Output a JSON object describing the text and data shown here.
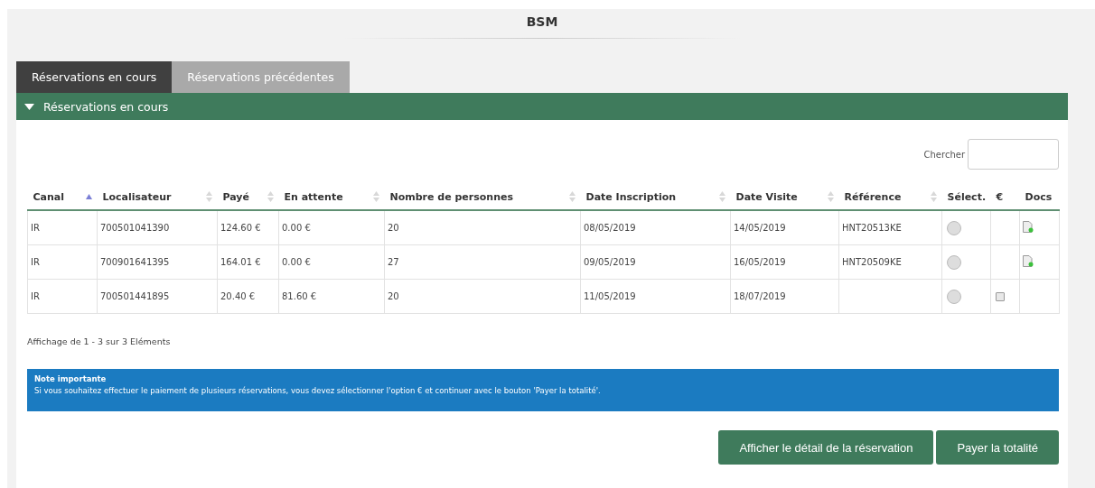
{
  "header": {
    "title": "BSM"
  },
  "tabs": [
    {
      "label": "Réservations en cours",
      "selected": true
    },
    {
      "label": "Réservations précédentes",
      "selected": false
    }
  ],
  "panel": {
    "title": "Réservations en cours",
    "expanded": true
  },
  "search": {
    "label": "Chercher"
  },
  "table": {
    "columns": [
      {
        "label": "Canal",
        "sortable": true,
        "sorted": true
      },
      {
        "label": "Localisateur",
        "sortable": true,
        "sorted": false
      },
      {
        "label": "Payé",
        "sortable": true,
        "sorted": false
      },
      {
        "label": "En attente",
        "sortable": true,
        "sorted": false
      },
      {
        "label": "Nombre de personnes",
        "sortable": true,
        "sorted": false
      },
      {
        "label": "Date Inscription",
        "sortable": true,
        "sorted": false
      },
      {
        "label": "Date Visite",
        "sortable": true,
        "sorted": false
      },
      {
        "label": "Référence",
        "sortable": true,
        "sorted": false
      },
      {
        "label": "Sélect."
      },
      {
        "label": "€"
      },
      {
        "label": "Docs"
      }
    ],
    "rows": [
      {
        "cells": [
          "IR",
          "700501041390",
          "124.60 €",
          "0.00 €",
          "20",
          "08/05/2019",
          "14/05/2019",
          "HNT20513KE"
        ],
        "selected": false,
        "has_docs": true
      },
      {
        "cells": [
          "IR",
          "700901641395",
          "164.01 €",
          "0.00 €",
          "27",
          "09/05/2019",
          "16/05/2019",
          "HNT20509KE"
        ],
        "selected": false,
        "has_docs": true
      },
      {
        "cells": [
          "IR",
          "700501441895",
          "20.40 €",
          "81.60 €",
          "20",
          "11/05/2019",
          "18/07/2019",
          ""
        ],
        "selected": false,
        "pay_option": false
      }
    ]
  },
  "info": "Affichage de 1 - 3 sur 3 Eléments",
  "note": {
    "title": "Note importante",
    "text": "Si vous souhaitez effectuer le paiement de plusieurs réservations, vous devez sélectionner l'option € et continuer avec le bouton 'Payer la totalité'."
  },
  "buttons": [
    "Afficher le détail de la réservation",
    "Payer la totalité"
  ]
}
